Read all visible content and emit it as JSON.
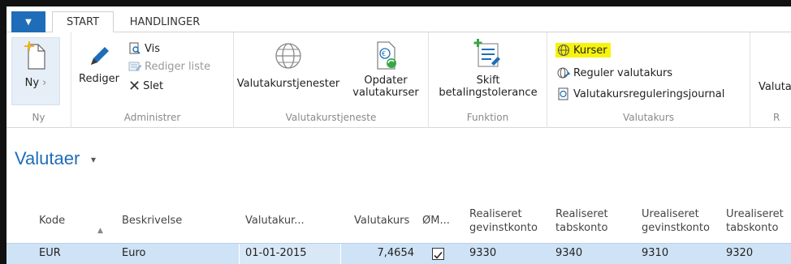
{
  "ribbon": {
    "tabs": [
      "START",
      "HANDLINGER"
    ],
    "groups": {
      "ny": {
        "label": "Ny",
        "buttons": {
          "ny": "Ny"
        }
      },
      "administrer": {
        "label": "Administrer",
        "buttons": {
          "rediger": "Rediger",
          "vis": "Vis",
          "rediger_liste": "Rediger liste",
          "slet": "Slet"
        }
      },
      "valutakurstjeneste": {
        "label": "Valutakurstjeneste",
        "buttons": {
          "valutakurstjenester": "Valutakurstjenester",
          "opdater_1": "Opdater",
          "opdater_2": "valutakurser"
        }
      },
      "funktion": {
        "label": "Funktion",
        "buttons": {
          "skift_1": "Skift",
          "skift_2": "betalingstolerance"
        }
      },
      "valutakurs": {
        "label": "Valutakurs",
        "buttons": {
          "kurser": "Kurser",
          "reguler": "Reguler valutakurs",
          "journal": "Valutakursreguleringsjournal"
        }
      },
      "cut_group": {
        "label": "R",
        "button": "Valuta"
      }
    }
  },
  "page": {
    "title": "Valutaer",
    "title_arrow": "▾"
  },
  "table": {
    "headers": {
      "kode": "Kode",
      "beskrivelse": "Beskrivelse",
      "valutakur_dato": "Valutakur...",
      "valutakurs": "Valutakurs",
      "om": "ØM...",
      "realiseret_gevinst_1": "Realiseret",
      "realiseret_gevinst_2": "gevinstkonto",
      "realiseret_tab_1": "Realiseret",
      "realiseret_tab_2": "tabskonto",
      "urealiseret_gevinst_1": "Urealiseret",
      "urealiseret_gevinst_2": "gevinstkonto",
      "urealiseret_tab_1": "Urealiseret",
      "urealiseret_tab_2": "tabskonto"
    },
    "rows": [
      {
        "kode": "EUR",
        "beskrivelse": "Euro",
        "dato": "01-01-2015",
        "valutakurs": "7,4654",
        "om": true,
        "realiseret_gevinst": "9330",
        "realiseret_tab": "9340",
        "urealiseret_gevinst": "9310",
        "urealiseret_tab": "9320"
      }
    ]
  },
  "colors": {
    "accent": "#1f6db8",
    "highlight": "#f7f30c",
    "selected_row": "#cfe3f6"
  }
}
